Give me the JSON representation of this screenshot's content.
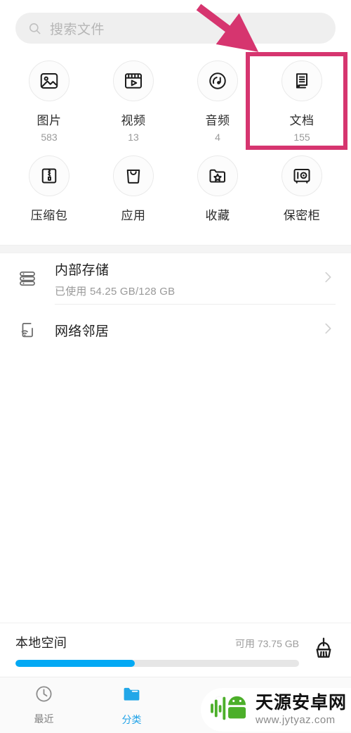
{
  "search": {
    "placeholder": "搜索文件",
    "icon": "search-icon"
  },
  "categories": {
    "row1": [
      {
        "label": "图片",
        "count": "583",
        "icon": "image-icon"
      },
      {
        "label": "视频",
        "count": "13",
        "icon": "video-icon"
      },
      {
        "label": "音频",
        "count": "4",
        "icon": "audio-icon"
      },
      {
        "label": "文档",
        "count": "155",
        "icon": "document-icon",
        "highlighted": true
      }
    ],
    "row2": [
      {
        "label": "压缩包",
        "count": "",
        "icon": "archive-icon"
      },
      {
        "label": "应用",
        "count": "",
        "icon": "apps-bag-icon"
      },
      {
        "label": "收藏",
        "count": "",
        "icon": "favorite-folder-icon"
      },
      {
        "label": "保密柜",
        "count": "",
        "icon": "safe-box-icon"
      }
    ]
  },
  "storage_list": [
    {
      "title": "内部存储",
      "subtitle": "已使用 54.25 GB/128 GB",
      "icon": "storage-stack-icon",
      "chevron": "chevron-right-icon"
    },
    {
      "title": "网络邻居",
      "subtitle": "",
      "icon": "network-wifi-icon",
      "chevron": "chevron-right-icon"
    }
  ],
  "local_space": {
    "title": "本地空间",
    "available": "可用 73.75 GB",
    "used_percent": 42,
    "bar_color": "#03a9f4",
    "clean_icon": "broom-clean-icon"
  },
  "bottom_nav": [
    {
      "label": "最近",
      "icon": "clock-icon",
      "active": false
    },
    {
      "label": "分类",
      "icon": "folder-icon",
      "active": true
    },
    {
      "label": "",
      "icon": "cloud-icon",
      "active": false
    },
    {
      "label": "",
      "icon": "profile-icon",
      "active": false
    }
  ],
  "annotations": {
    "arrow_color": "#d6356f",
    "box_color": "#d6356f"
  },
  "watermark": {
    "name": "天源安卓网",
    "url": "www.jytyaz.com",
    "logo_color": "#4caf2a"
  }
}
